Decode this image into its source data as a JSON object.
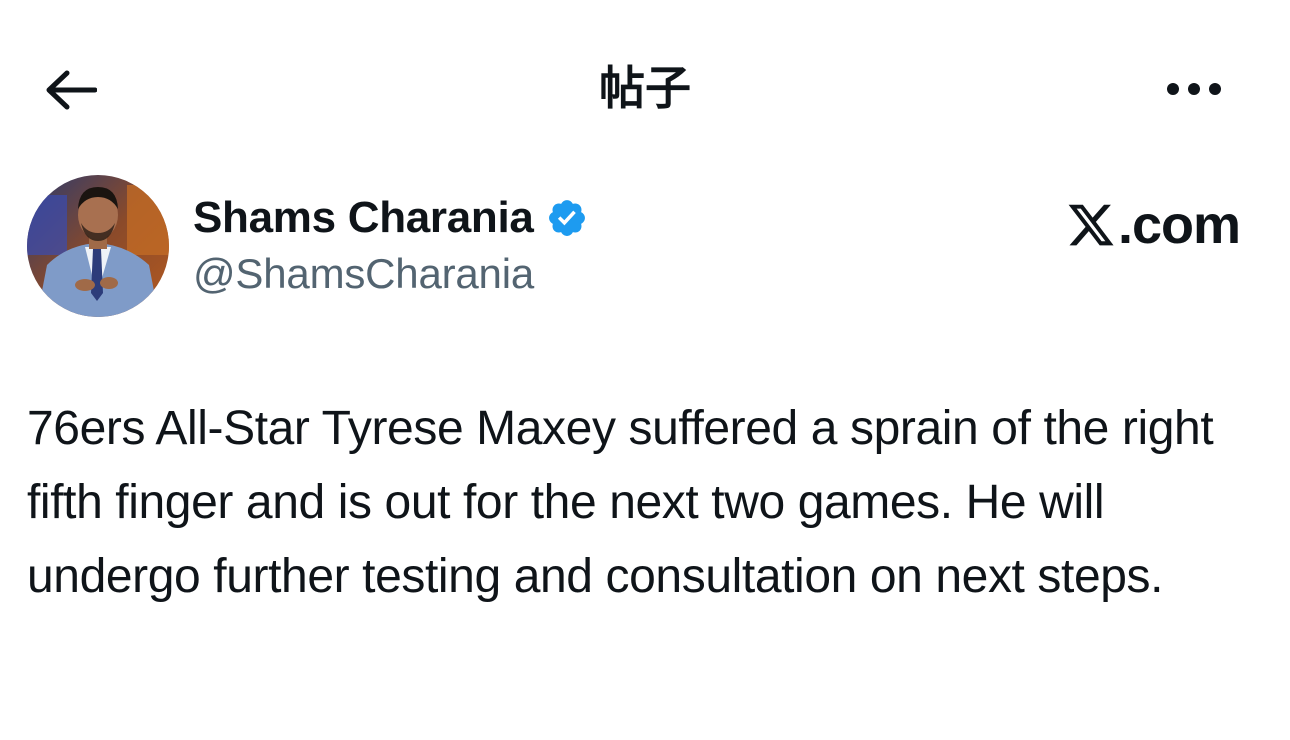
{
  "header": {
    "title": "帖子",
    "back_icon": "arrow-left-icon",
    "more_icon": "more-horizontal-icon"
  },
  "author": {
    "name": "Shams Charania",
    "handle": "@ShamsCharania",
    "verified": true,
    "verified_color": "#1d9bf0"
  },
  "source": {
    "brand_suffix": ".com",
    "logo_icon": "x-logo-icon"
  },
  "tweet": {
    "text": "76ers All-Star Tyrese Maxey suffered a sprain of the right fifth finger and is out for the next two games. He will undergo further testing and consultation on next steps."
  },
  "colors": {
    "text_primary": "#0f1419",
    "text_secondary": "#536471",
    "background": "#ffffff"
  }
}
